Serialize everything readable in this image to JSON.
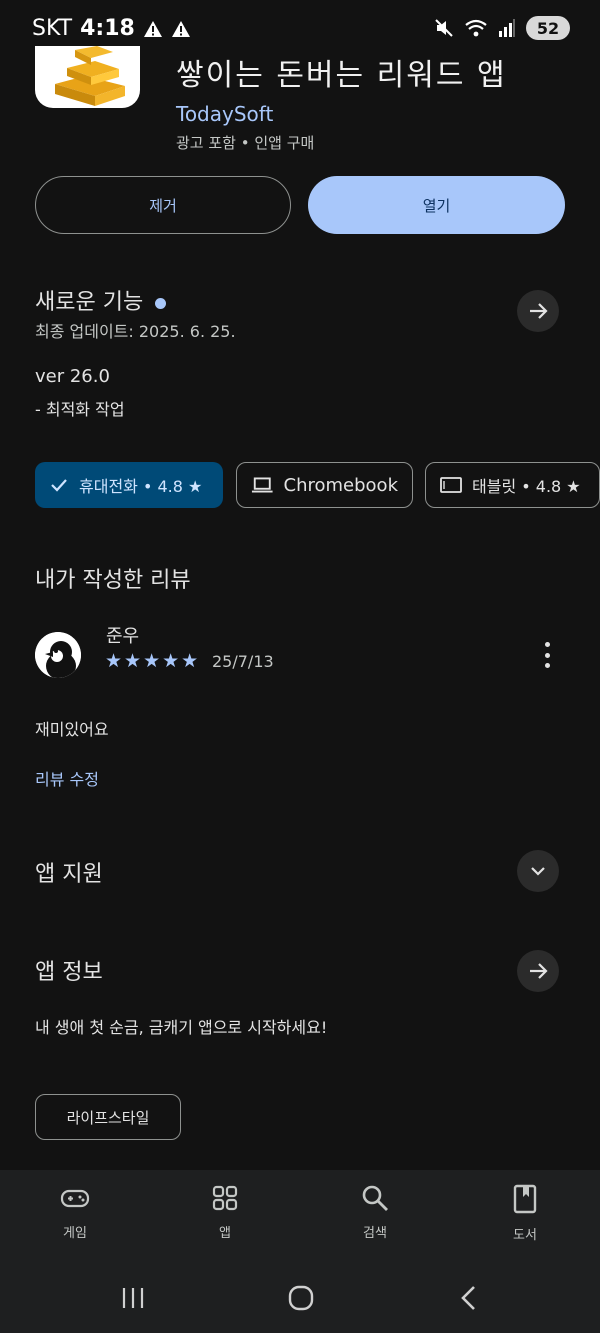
{
  "status_bar": {
    "carrier": "SKT",
    "time": "4:18",
    "battery": "52"
  },
  "app": {
    "title": "쌓이는 돈버는 리워드 앱",
    "developer": "TodaySoft",
    "meta": "광고 포함  •  인앱 구매",
    "remove_label": "제거",
    "open_label": "열기"
  },
  "whats_new": {
    "title": "새로운 기능",
    "updated": "최종 업데이트: 2025. 6. 25.",
    "version": "ver 26.0",
    "note": "- 최적화 작업"
  },
  "device_chips": [
    {
      "label": "휴대전화 • 4.8 ★",
      "selected": true
    },
    {
      "label": "Chromebook",
      "selected": false
    },
    {
      "label": "태블릿 • 4.8 ★",
      "selected": false
    }
  ],
  "my_review": {
    "title": "내가 작성한 리뷰",
    "reviewer": "준우",
    "stars": "★★★★★",
    "rating": 5,
    "date": "25/7/13",
    "body": "재미있어요",
    "edit_label": "리뷰 수정"
  },
  "app_support": {
    "title": "앱 지원"
  },
  "app_info": {
    "title": "앱 정보",
    "description": "내 생애 첫 순금, 금캐기 앱으로 시작하세요!",
    "tag": "라이프스타일"
  },
  "bottom_nav": [
    {
      "label": "게임",
      "icon": "gamepad-icon"
    },
    {
      "label": "앱",
      "icon": "apps-grid-icon"
    },
    {
      "label": "검색",
      "icon": "search-icon"
    },
    {
      "label": "도서",
      "icon": "book-icon"
    }
  ],
  "colors": {
    "background": "#121212",
    "accent": "#a8c7fa",
    "selected_chip": "#004a77"
  }
}
